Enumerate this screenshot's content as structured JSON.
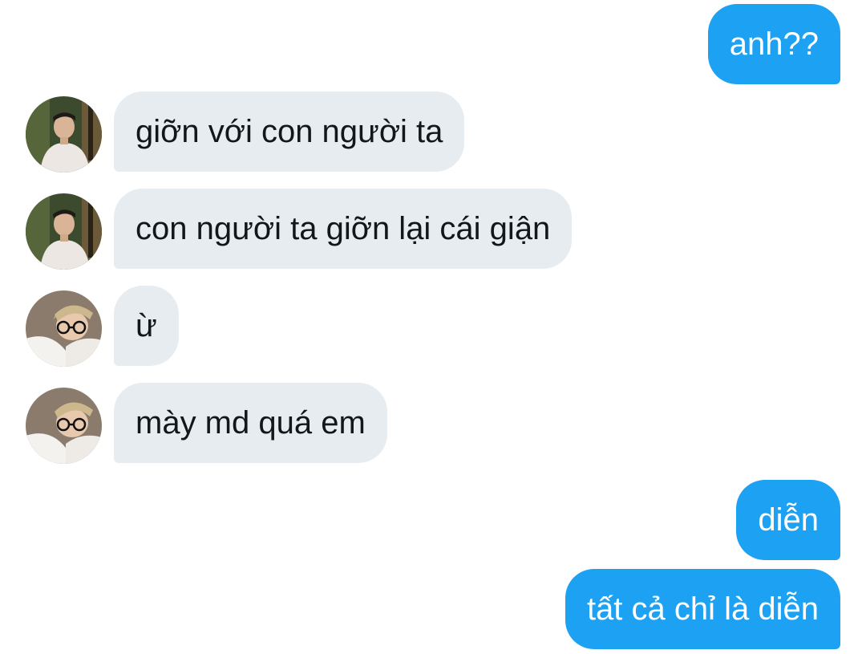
{
  "messages": [
    {
      "sender": "me",
      "text": "anh??"
    },
    {
      "sender": "contact_1",
      "avatar": "avatar-photo-dark-hair",
      "text": "giỡn với con người ta"
    },
    {
      "sender": "contact_1",
      "avatar": "avatar-photo-dark-hair",
      "text": "con người ta giỡn lại cái giận"
    },
    {
      "sender": "contact_2",
      "avatar": "avatar-photo-blonde-glasses",
      "text": "ừ"
    },
    {
      "sender": "contact_2",
      "avatar": "avatar-photo-blonde-glasses",
      "text": "mày md quá em"
    },
    {
      "sender": "me",
      "text": "diễn"
    },
    {
      "sender": "me",
      "text": "tất cả chỉ là diễn"
    }
  ],
  "colors": {
    "outgoing_bubble": "#1da1f2",
    "incoming_bubble": "#e6ecf0",
    "outgoing_text": "#ffffff",
    "incoming_text": "#14171a"
  }
}
